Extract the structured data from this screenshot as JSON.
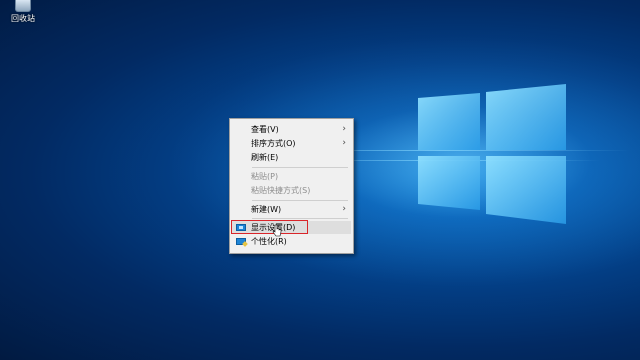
{
  "desktop": {
    "recycle_bin_label": "回收站"
  },
  "context_menu": {
    "items": [
      {
        "label": "查看(V)",
        "has_submenu": true,
        "enabled": true
      },
      {
        "label": "排序方式(O)",
        "has_submenu": true,
        "enabled": true
      },
      {
        "label": "刷新(E)",
        "has_submenu": false,
        "enabled": true
      },
      {
        "label": "粘贴(P)",
        "has_submenu": false,
        "enabled": false
      },
      {
        "label": "粘贴快捷方式(S)",
        "has_submenu": false,
        "enabled": false
      },
      {
        "label": "新建(W)",
        "has_submenu": true,
        "enabled": true
      },
      {
        "label": "显示设置(D)",
        "has_submenu": false,
        "enabled": true,
        "icon": "display-settings-icon",
        "highlighted": true
      },
      {
        "label": "个性化(R)",
        "has_submenu": false,
        "enabled": true,
        "icon": "personalize-icon"
      }
    ],
    "submenu_arrow": "›"
  },
  "colors": {
    "highlight_box": "#d9252a",
    "menu_background": "#f0f0f0"
  }
}
